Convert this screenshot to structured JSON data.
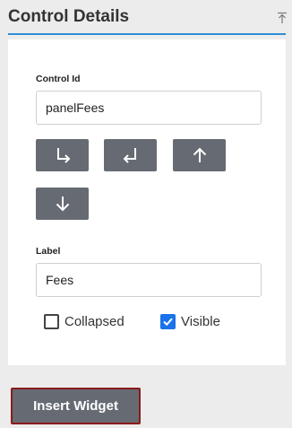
{
  "header": {
    "title": "Control Details",
    "collapse_icon": "collapse-to-top-icon"
  },
  "panel": {
    "control_id": {
      "label": "Control Id",
      "value": "panelFees"
    },
    "move_buttons": [
      {
        "name": "move-into-button",
        "icon": "arrow-down-right-icon"
      },
      {
        "name": "move-out-button",
        "icon": "arrow-return-left-icon"
      },
      {
        "name": "move-up-button",
        "icon": "arrow-up-icon"
      },
      {
        "name": "move-down-button",
        "icon": "arrow-down-icon"
      }
    ],
    "label_field": {
      "label": "Label",
      "value": "Fees"
    },
    "checkboxes": {
      "collapsed": {
        "label": "Collapsed",
        "checked": false
      },
      "visible": {
        "label": "Visible",
        "checked": true
      }
    }
  },
  "footer": {
    "insert_label": "Insert Widget"
  },
  "colors": {
    "accent_underline": "#2e8fd6",
    "button_bg": "#666b73",
    "insert_border": "#8b1b1b",
    "checkbox_checked": "#1a73e8"
  }
}
